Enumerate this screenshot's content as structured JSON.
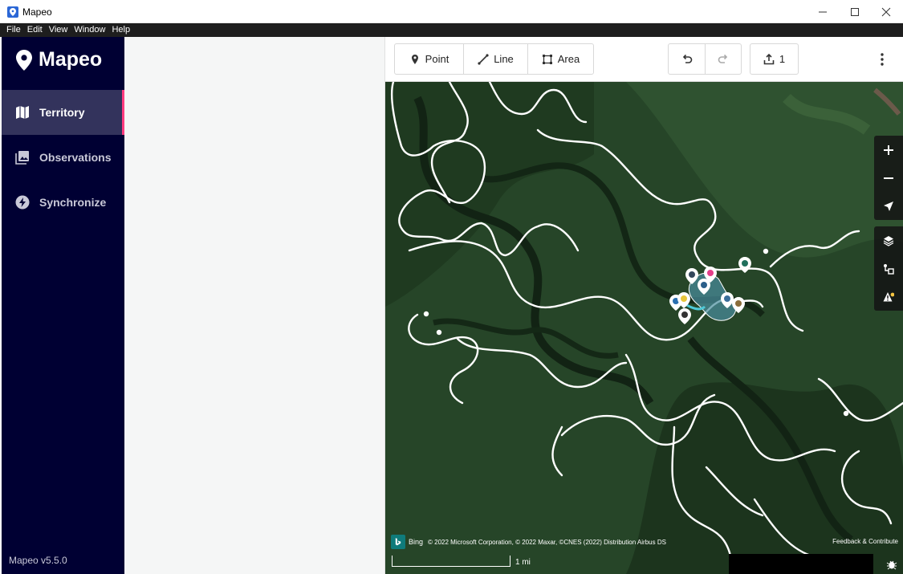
{
  "window": {
    "title": "Mapeo"
  },
  "menu": [
    "File",
    "Edit",
    "View",
    "Window",
    "Help"
  ],
  "sidebar": {
    "brand": "Mapeo",
    "items": [
      {
        "label": "Territory",
        "icon": "map-icon",
        "active": true
      },
      {
        "label": "Observations",
        "icon": "photo-library-icon",
        "active": false
      },
      {
        "label": "Synchronize",
        "icon": "bolt-icon",
        "active": false
      }
    ],
    "version": "Mapeo v5.5.0"
  },
  "toolbar": {
    "point_label": "Point",
    "line_label": "Line",
    "area_label": "Area",
    "upload_count": "1"
  },
  "map": {
    "attribution_brand": "Bing",
    "attribution": "© 2022 Microsoft Corporation, © 2022 Maxar, ©CNES (2022) Distribution Airbus DS",
    "feedback": "Feedback & Contribute",
    "scale": "1 mi",
    "controls": [
      "zoom-in-icon",
      "zoom-out-icon",
      "locate-icon",
      "layers-icon",
      "data-layer-icon",
      "issues-icon"
    ]
  },
  "colors": {
    "sidebar_bg": "#000033",
    "active_item_bg": "#33335c",
    "active_indicator": "#ff3b7f",
    "menubar_bg": "#1e1e1e",
    "panel_bg": "#f5f6f6"
  }
}
